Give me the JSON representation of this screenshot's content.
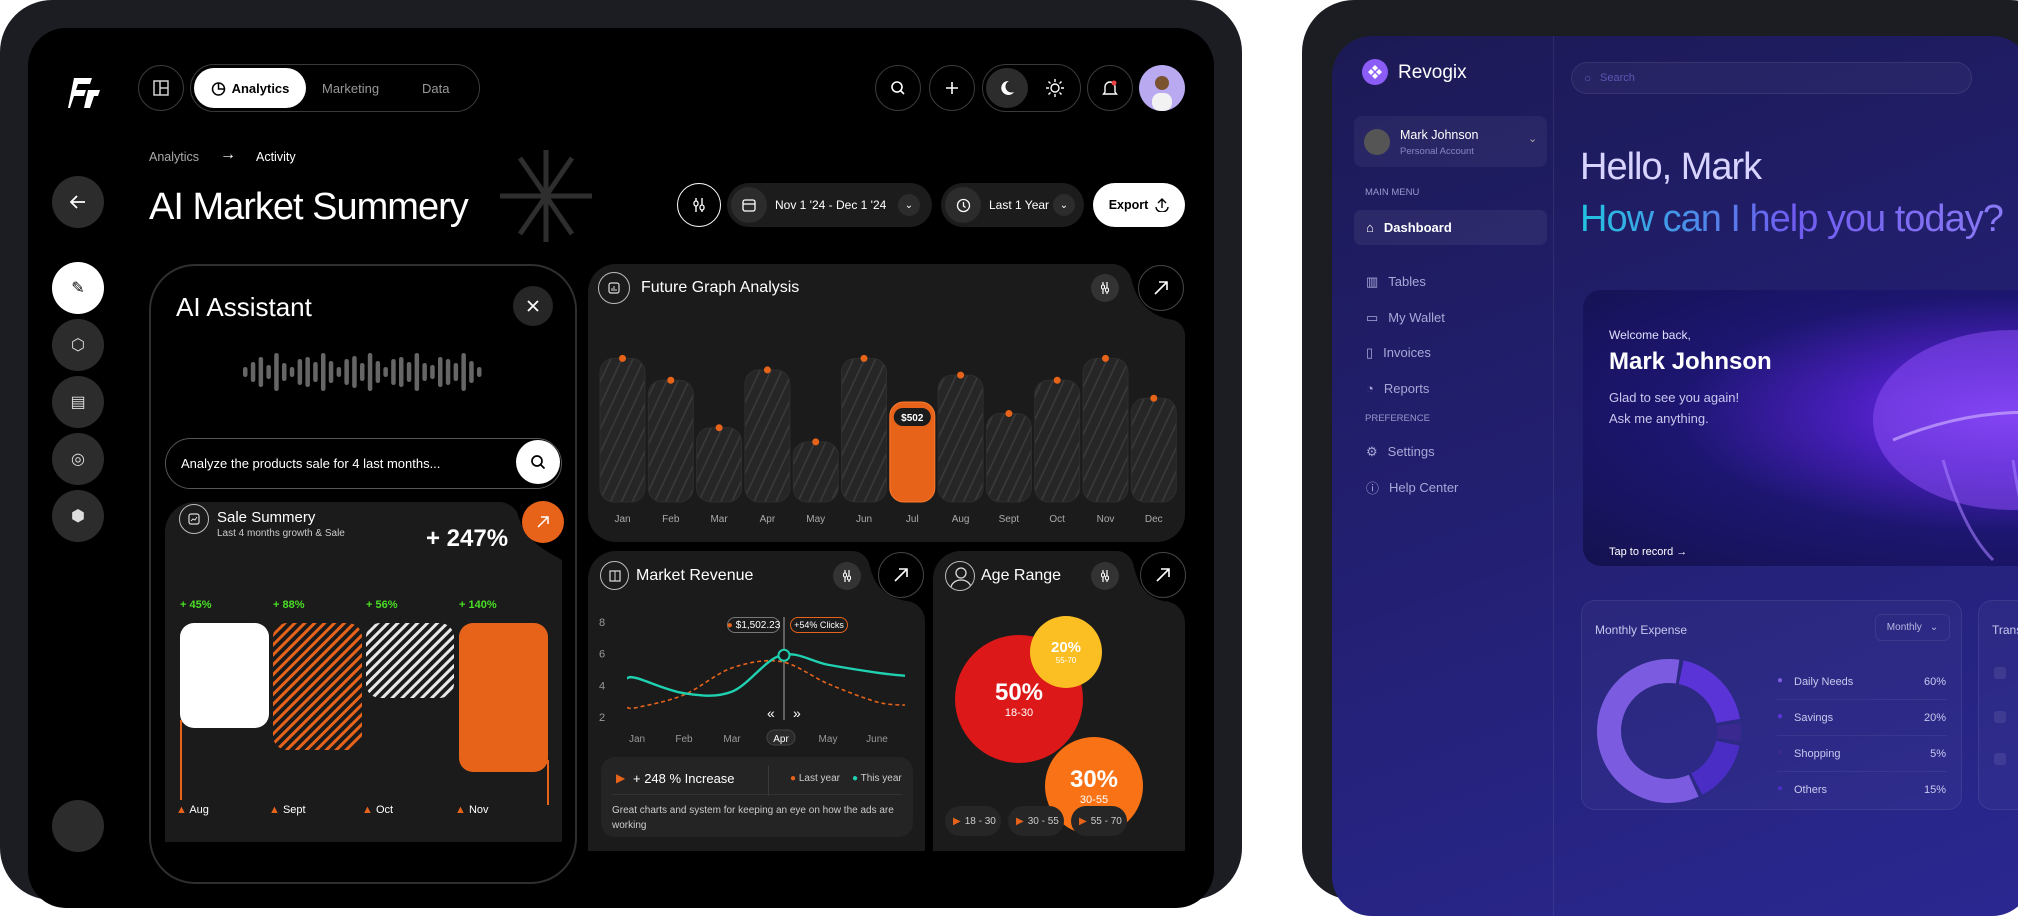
{
  "left_app": {
    "tabs": [
      {
        "label": "Analytics",
        "active": true
      },
      {
        "label": "Marketing",
        "active": false
      },
      {
        "label": "Data",
        "active": false
      }
    ],
    "breadcrumb": {
      "parent": "Analytics",
      "current": "Activity"
    },
    "page_title": "AI Market Summery",
    "controls": {
      "date_range": "Nov 1 '24 - Dec 1 '24",
      "period": "Last 1 Year",
      "export_label": "Export"
    },
    "sidebar_icons": [
      "magic-wand-icon",
      "cube-icon",
      "document-icon",
      "chat-icon",
      "settings-hex-icon"
    ],
    "ai_assistant": {
      "title": "AI Assistant",
      "input_value": "Analyze the products sale for 4 last months...",
      "sale_summary": {
        "title": "Sale Summery",
        "subtitle": "Last 4 months growth & Sale",
        "total": "+ 247%"
      }
    },
    "future_graph": {
      "title": "Future Graph Analysis"
    },
    "market_revenue": {
      "title": "Market Revenue",
      "tooltip_value": "$1,502.23",
      "tooltip_clicks": "+54% Clicks",
      "increase": "+ 248 % Increase",
      "description": "Great charts and system for keeping an eye on how the ads are working"
    },
    "age_range": {
      "title": "Age Range",
      "chips": [
        "18 - 30",
        "30 - 55",
        "55 - 70"
      ]
    }
  },
  "chart_data": [
    {
      "type": "bar",
      "title": "Sale Summery",
      "categories": [
        "Aug",
        "Sept",
        "Oct",
        "Nov"
      ],
      "labels": [
        "+ 45%",
        "+ 88%",
        "+ 56%",
        "+ 140%"
      ],
      "values": [
        45,
        88,
        56,
        140
      ]
    },
    {
      "type": "bar",
      "title": "Future Graph Analysis",
      "categories": [
        "Jan",
        "Feb",
        "Mar",
        "Apr",
        "May",
        "Jun",
        "Jul",
        "Aug",
        "Sept",
        "Oct",
        "Nov",
        "Dec"
      ],
      "values": [
        721,
        611,
        373,
        663,
        302,
        721,
        502,
        637,
        444,
        611,
        721,
        521
      ],
      "highlight": {
        "category": "Jul",
        "label": "$502"
      },
      "colors": {
        "bar": "#2a2a2a",
        "highlight": "#e8631a",
        "dot": "#e8631a"
      }
    },
    {
      "type": "line",
      "title": "Market Revenue",
      "categories": [
        "Jan",
        "Feb",
        "Mar",
        "Apr",
        "May",
        "June"
      ],
      "selected": "Apr",
      "yticks": [
        "8",
        "6",
        "4",
        "2"
      ],
      "ylim": [
        2,
        8
      ],
      "series": [
        {
          "name": "Last year",
          "color": "#e8631a",
          "dashed": true,
          "values": [
            2.6,
            3.4,
            5.1,
            5.5,
            4.1,
            2.95
          ]
        },
        {
          "name": "This year",
          "color": "#1fd1b0",
          "values": [
            4.45,
            3.5,
            3.6,
            5.9,
            5.3,
            4.8
          ]
        }
      ]
    },
    {
      "type": "bubble",
      "title": "Age Range",
      "items": [
        {
          "value": "50%",
          "label": "18-30",
          "color": "#dd1818"
        },
        {
          "value": "20%",
          "label": "55-70",
          "color": "#fbbf24"
        },
        {
          "value": "30%",
          "label": "30-55",
          "color": "#f97316"
        }
      ]
    },
    {
      "type": "pie",
      "title": "Monthly Expense",
      "categories": [
        "Daily Needs",
        "Savings",
        "Shopping",
        "Others"
      ],
      "values": [
        60,
        20,
        5,
        15
      ],
      "labels": [
        "60%",
        "20%",
        "5%",
        "15%"
      ],
      "colors": [
        "#7b5ce0",
        "#5b34d8",
        "#3a2a90",
        "#4a2dc4"
      ]
    }
  ],
  "right_app": {
    "brand": "Revogix",
    "search_placeholder": "Search",
    "account": {
      "name": "Mark Johnson",
      "type": "Personal Account"
    },
    "main_menu_label": "MAIN MENU",
    "menu": [
      "Dashboard",
      "Tables",
      "My Wallet",
      "Invoices",
      "Reports"
    ],
    "preference_label": "PREFERENCE",
    "preference": [
      "Settings",
      "Help Center"
    ],
    "greeting": "Hello, Mark",
    "question": "How can I help you today?",
    "welcome": {
      "line": "Welcome back,",
      "name": "Mark Johnson",
      "msg1": "Glad to see you again!",
      "msg2": "Ask me anything.",
      "cta": "Tap to record"
    },
    "expense": {
      "title": "Monthly Expense",
      "period": "Monthly"
    },
    "transactions_title": "Trans"
  }
}
